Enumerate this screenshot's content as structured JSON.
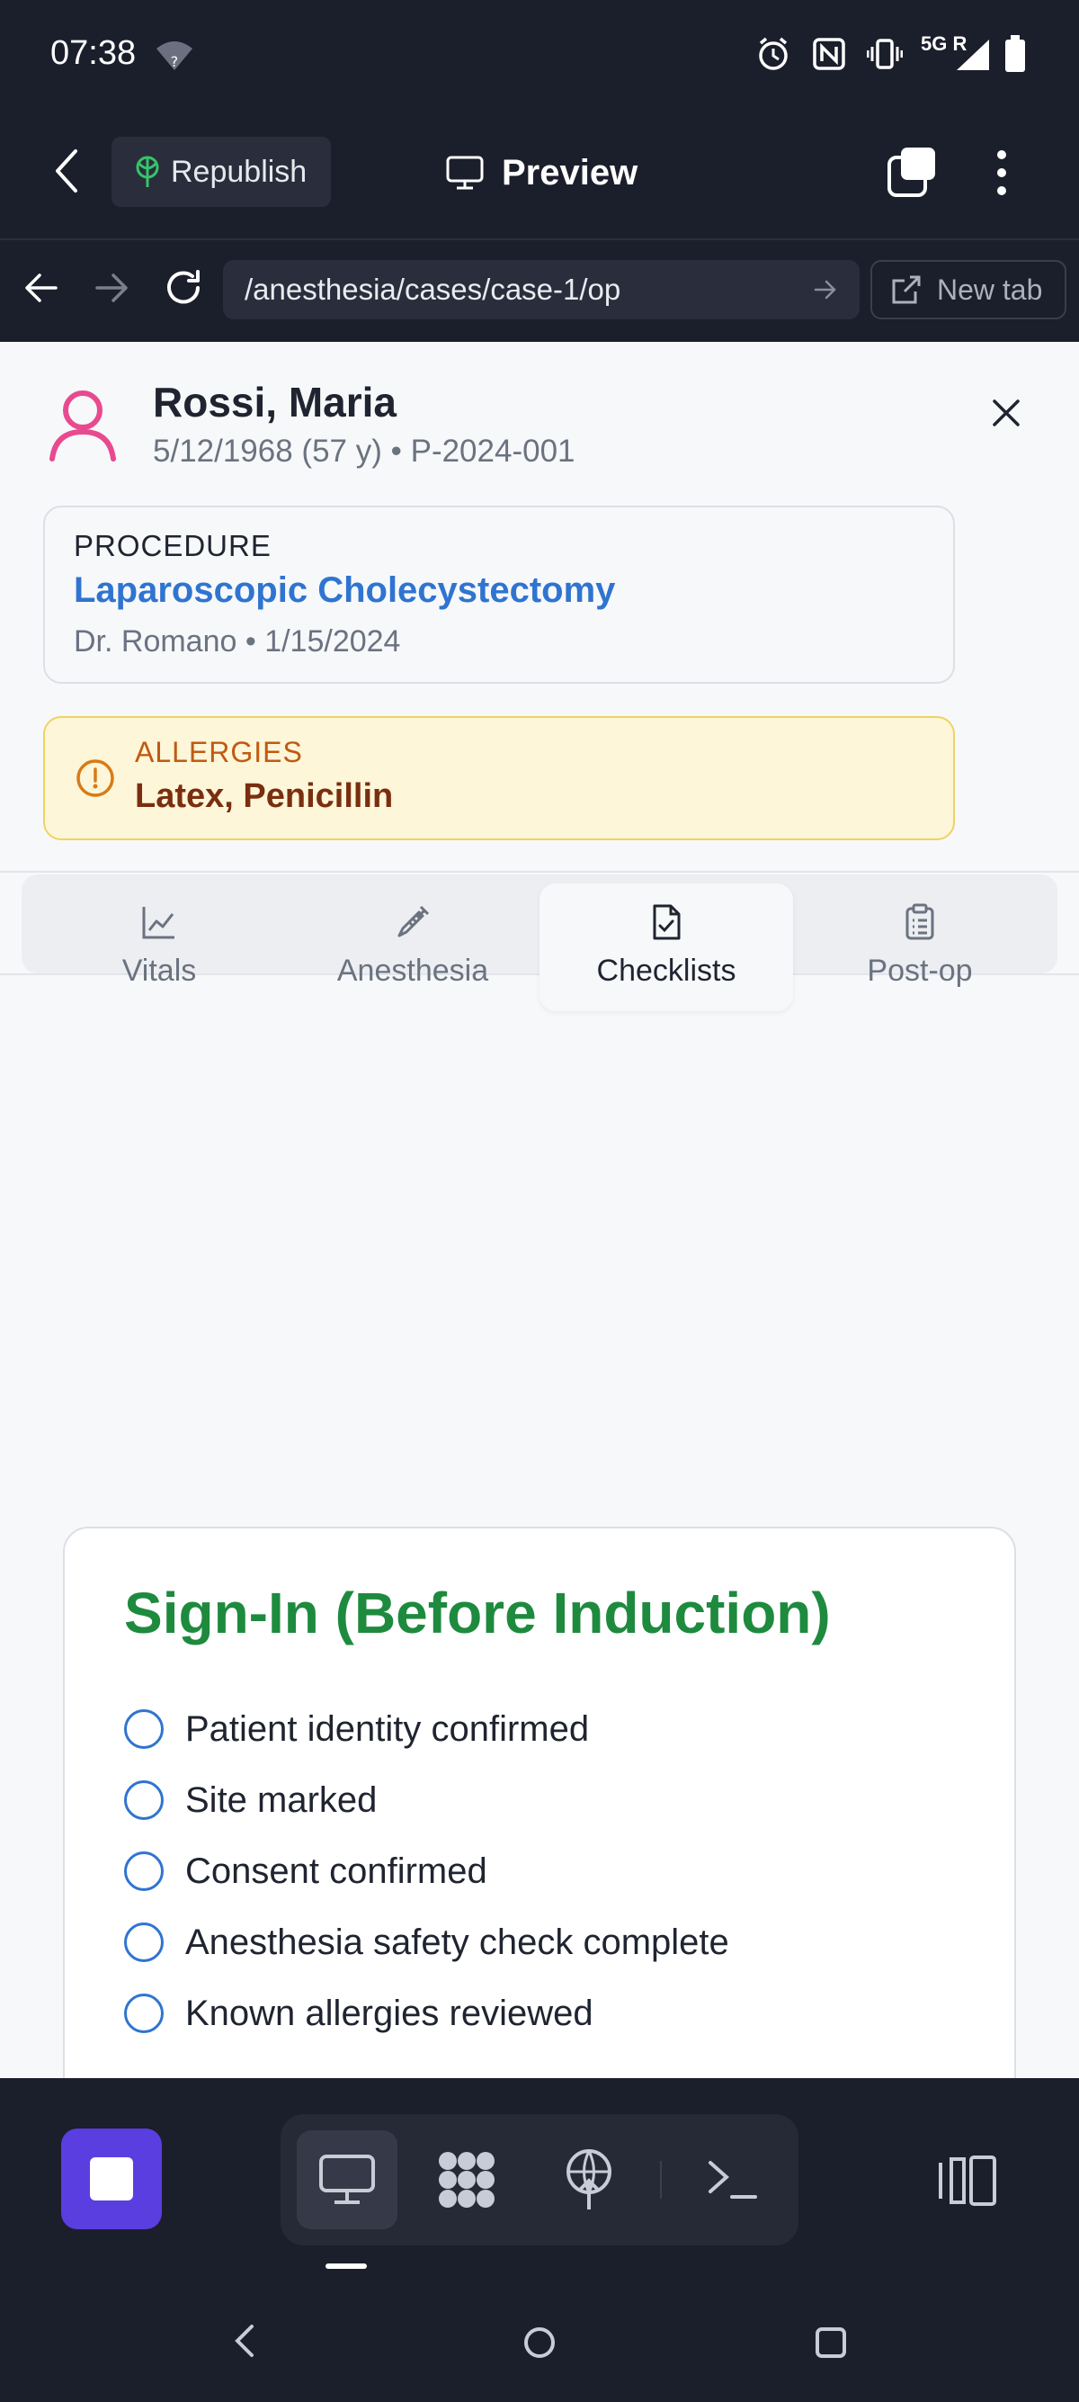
{
  "status_bar": {
    "time": "07:38",
    "network": "5G R"
  },
  "app_bar": {
    "republish_label": "Republish",
    "preview_label": "Preview"
  },
  "browser": {
    "url": "/anesthesia/cases/case-1/op",
    "new_tab_label": "New tab"
  },
  "patient": {
    "name": "Rossi, Maria",
    "subtitle": "5/12/1968 (57 y) • P-2024-001"
  },
  "procedure": {
    "label": "PROCEDURE",
    "name": "Laparoscopic Cholecystectomy",
    "subtitle": "Dr. Romano • 1/15/2024"
  },
  "allergies": {
    "label": "ALLERGIES",
    "value": "Latex, Penicillin"
  },
  "tabs": [
    {
      "label": "Vitals",
      "icon": "line-chart-icon",
      "active": false
    },
    {
      "label": "Anesthesia",
      "icon": "syringe-icon",
      "active": false
    },
    {
      "label": "Checklists",
      "icon": "file-check-icon",
      "active": true
    },
    {
      "label": "Post-op",
      "icon": "clipboard-list-icon",
      "active": false
    }
  ],
  "checklist": {
    "title": "Sign-In (Before Induction)",
    "items": [
      "Patient identity confirmed",
      "Site marked",
      "Consent confirmed",
      "Anesthesia safety check complete",
      "Known allergies reviewed"
    ]
  },
  "colors": {
    "accent_blue": "#2f74d0",
    "checklist_green": "#1e8a3e",
    "allergy_bg": "#fdf6d8",
    "stop_purple": "#5a3ee0"
  }
}
